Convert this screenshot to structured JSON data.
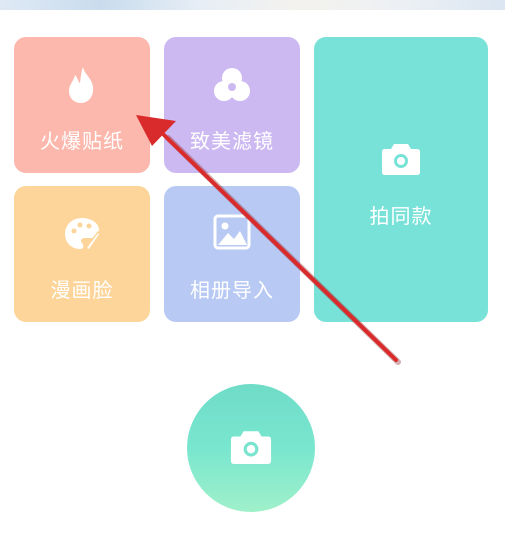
{
  "grid": {
    "tiles": [
      {
        "label": "火爆贴纸",
        "icon": "flame-icon",
        "color": "#fdb8ad"
      },
      {
        "label": "致美滤镜",
        "icon": "filter-circles-icon",
        "color": "#cdb9f2"
      },
      {
        "label": "漫画脸",
        "icon": "palette-icon",
        "color": "#fdd59a"
      },
      {
        "label": "相册导入",
        "icon": "image-icon",
        "color": "#b8c9f4"
      },
      {
        "label": "拍同款",
        "icon": "camera-icon",
        "color": "#79e2d8"
      }
    ]
  },
  "shutter": {
    "icon": "camera-icon",
    "color": "#79e6cf"
  },
  "annotation": {
    "icon": "red-arrow-pointer",
    "color": "#d92b2b"
  }
}
